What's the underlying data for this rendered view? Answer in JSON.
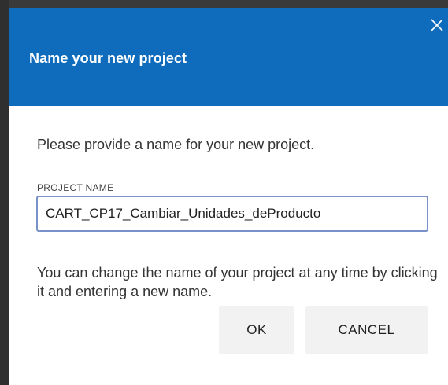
{
  "dialog": {
    "title": "Name your new project",
    "close_icon": "close-icon",
    "intro": "Please provide a name for your new project.",
    "field": {
      "label": "PROJECT NAME",
      "value": "CART_CP17_Cambiar_Unidades_deProducto"
    },
    "help_text": "You can change the name of your project at any time by clicking it and entering a new name.",
    "buttons": {
      "ok_label": "OK",
      "cancel_label": "CANCEL"
    }
  },
  "colors": {
    "header": "#0f6cbd",
    "input_border": "#7891c9",
    "button_bg": "#f2f2f2"
  }
}
